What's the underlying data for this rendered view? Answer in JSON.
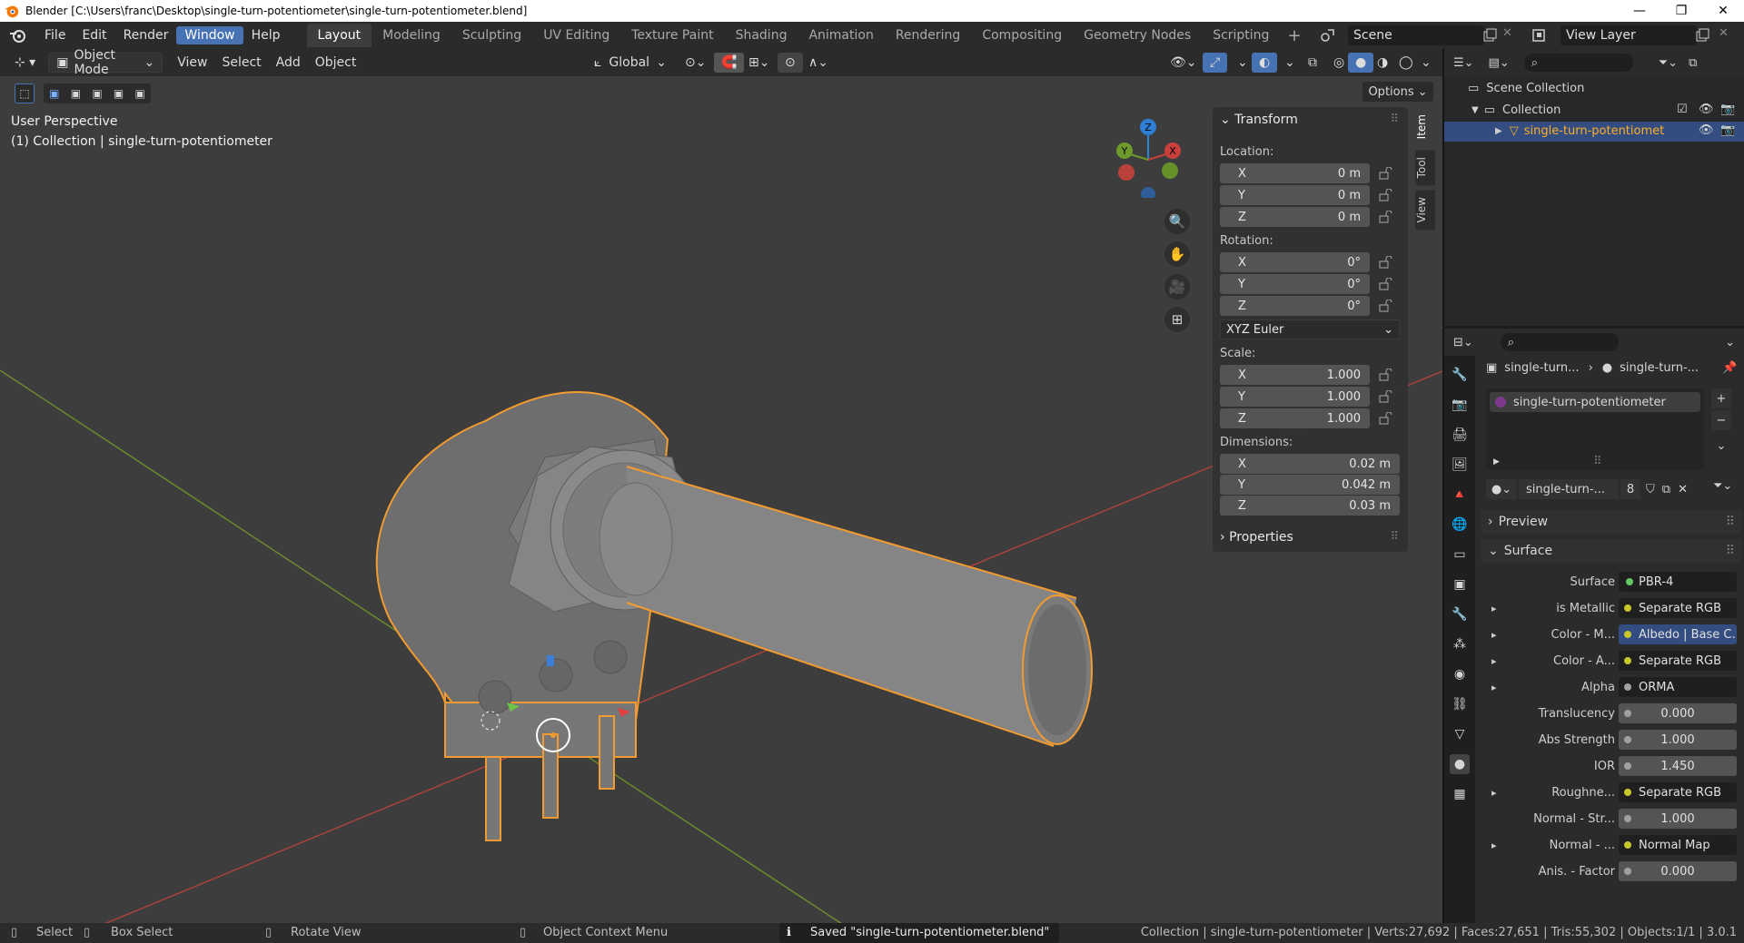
{
  "window": {
    "title": "Blender [C:\\Users\\franc\\Desktop\\single-turn-potentiometer\\single-turn-potentiometer.blend]",
    "minimize": "—",
    "maximize": "❐",
    "close": "✕"
  },
  "menu": {
    "items": [
      "File",
      "Edit",
      "Render",
      "Window",
      "Help"
    ],
    "active": "Window"
  },
  "workspaces": {
    "tabs": [
      "Layout",
      "Modeling",
      "Sculpting",
      "UV Editing",
      "Texture Paint",
      "Shading",
      "Animation",
      "Rendering",
      "Compositing",
      "Geometry Nodes",
      "Scripting"
    ],
    "active": "Layout",
    "add": "+"
  },
  "scene": {
    "name": "Scene",
    "view_layer": "View Layer"
  },
  "viewport_header": {
    "mode": "Object Mode",
    "menus": [
      "View",
      "Select",
      "Add",
      "Object"
    ],
    "orientation": "Global",
    "options": "Options"
  },
  "viewport": {
    "perspective": "User Perspective",
    "collection_info": "(1) Collection | single-turn-potentiometer",
    "gizmo": {
      "x": "X",
      "y": "Y",
      "z": "Z"
    }
  },
  "npanel": {
    "header": "Transform",
    "location_label": "Location:",
    "location": [
      {
        "axis": "X",
        "value": "0 m"
      },
      {
        "axis": "Y",
        "value": "0 m"
      },
      {
        "axis": "Z",
        "value": "0 m"
      }
    ],
    "rotation_label": "Rotation:",
    "rotation": [
      {
        "axis": "X",
        "value": "0°"
      },
      {
        "axis": "Y",
        "value": "0°"
      },
      {
        "axis": "Z",
        "value": "0°"
      }
    ],
    "rotation_mode": "XYZ Euler",
    "scale_label": "Scale:",
    "scale": [
      {
        "axis": "X",
        "value": "1.000"
      },
      {
        "axis": "Y",
        "value": "1.000"
      },
      {
        "axis": "Z",
        "value": "1.000"
      }
    ],
    "dimensions_label": "Dimensions:",
    "dimensions": [
      {
        "axis": "X",
        "value": "0.02 m"
      },
      {
        "axis": "Y",
        "value": "0.042 m"
      },
      {
        "axis": "Z",
        "value": "0.03 m"
      }
    ],
    "properties": "Properties",
    "tabs": [
      "Item",
      "Tool",
      "View"
    ],
    "active_tab": "Item"
  },
  "outliner": {
    "scene_collection": "Scene Collection",
    "collection": "Collection",
    "object": "single-turn-potentiomet"
  },
  "properties": {
    "breadcrumb": [
      "single-turn...",
      "single-turn-..."
    ],
    "material_slot": "single-turn-potentiometer",
    "material_name": "single-turn-...",
    "user_count": "8",
    "preview": "Preview",
    "surface_header": "Surface",
    "surface_label": "Surface",
    "surface_value": "PBR-4",
    "rows": [
      {
        "label": "is Metallic",
        "value": "Separate RGB",
        "dot": "yellow",
        "expand": true
      },
      {
        "label": "Color - M...",
        "value": "Albedo | Base C...",
        "dot": "yellow",
        "expand": true,
        "highlight": true
      },
      {
        "label": "Color - A...",
        "value": "Separate RGB",
        "dot": "yellow",
        "expand": true
      },
      {
        "label": "Alpha",
        "value": "ORMA",
        "dot": "grey",
        "expand": true
      },
      {
        "label": "Translucency",
        "value": "0.000",
        "dot": "grey",
        "num": true
      },
      {
        "label": "Abs Strength",
        "value": "1.000",
        "dot": "grey",
        "num": true
      },
      {
        "label": "IOR",
        "value": "1.450",
        "dot": "grey",
        "num": true
      },
      {
        "label": "Roughne...",
        "value": "Separate RGB",
        "dot": "yellow",
        "expand": true
      },
      {
        "label": "Normal - Str...",
        "value": "1.000",
        "dot": "grey",
        "num": true
      },
      {
        "label": "Normal - ...",
        "value": "Normal Map",
        "dot": "yellow",
        "expand": true
      },
      {
        "label": "Anis. - Factor",
        "value": "0.000",
        "dot": "grey",
        "num": true
      }
    ]
  },
  "statusbar": {
    "select": "Select",
    "box_select": "Box Select",
    "rotate_view": "Rotate View",
    "context_menu": "Object Context Menu",
    "message": "Saved \"single-turn-potentiometer.blend\"",
    "stats": "Collection | single-turn-potentiometer | Verts:27,692 | Faces:27,651 | Tris:55,302 | Objects:1/1 | 3.0.1"
  },
  "colors": {
    "accent": "#4772b3",
    "selection_outline": "#f29b30",
    "axis_x": "#c8403b",
    "axis_y": "#6d9a2a",
    "axis_z": "#2f7fd6"
  }
}
